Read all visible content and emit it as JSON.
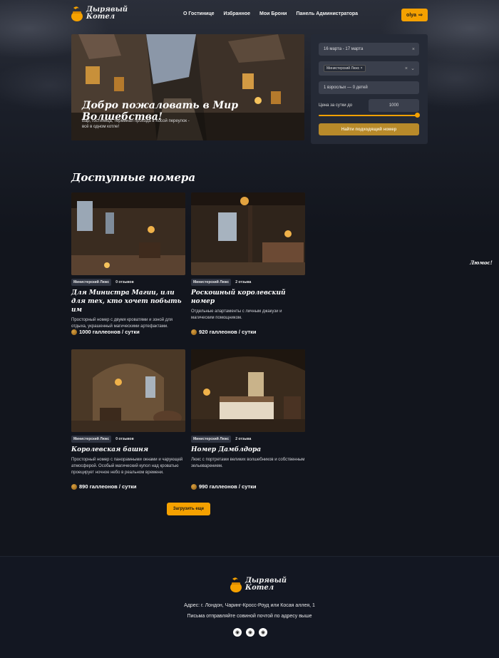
{
  "header": {
    "logo_text": "Дырявый Котел",
    "nav": [
      "О Гостинице",
      "Избранное",
      "Мои Брони",
      "Панель Администратора"
    ],
    "user_label": "olya",
    "colors": {
      "accent": "#f5a100",
      "background": "#12151d"
    }
  },
  "hero": {
    "title": "Добро пожаловать в Мир Волшебства!",
    "subtitle": "Бар, гостиница, терминал прохода в Косой переулок - всё в одном котле!"
  },
  "search": {
    "dates": "16 марта - 17 марта",
    "room_type_chip": "Министерский Люкс",
    "guests": "1 взрослых — 0 детей",
    "price_label": "Цена за сутки до",
    "price_value": "1000",
    "price_fraction": 1.0,
    "submit_label": "Найти подходящий номер"
  },
  "section": {
    "title": "Доступные номера"
  },
  "rooms": [
    {
      "badge": "Министерский Люкс",
      "reviews": "0 отзывов",
      "title": "Для Министра Магии, или для тех, кто хочет побыть им",
      "description": "Просторный номер с двумя кроватями и зоной для отдыха, украшенный магическими артефактами.",
      "price": "1000 галлеонов / сутки"
    },
    {
      "badge": "Министерский Люкс",
      "reviews": "2 отзыва",
      "title": "Роскошный королевский номер",
      "description": "Отдельные апартаменты с личным джакузи и магическим помощником.",
      "price": "920 галлеонов / сутки"
    },
    {
      "badge": "Министерский Люкс",
      "reviews": "0 отзывов",
      "title": "Королевская башня",
      "description": "Просторный номер с панорамными окнами и чарующей атмосферой. Особый магический купол над кроватью проецирует ночное небо в реальном времени.",
      "price": "890 галлеонов / сутки"
    },
    {
      "badge": "Министерский Люкс",
      "reviews": "2 отзыва",
      "title": "Номер Дамблдора",
      "description": "Люкс с портретами великих волшебников и собственным зельеварением.",
      "price": "990 галлеонов / сутки"
    }
  ],
  "load_more_label": "Загрузить еще",
  "side_label": "Люмос!",
  "footer": {
    "logo_text": "Дырявый Котел",
    "address": "Адрес: г. Лондон, Чаринг-Кросс-Роуд или Косая аллея, 1",
    "owl_mail": "Письма отправляйте совиной почтой по адресу выше",
    "social_icons": [
      "social-icon-1",
      "social-icon-2",
      "social-icon-3"
    ]
  }
}
